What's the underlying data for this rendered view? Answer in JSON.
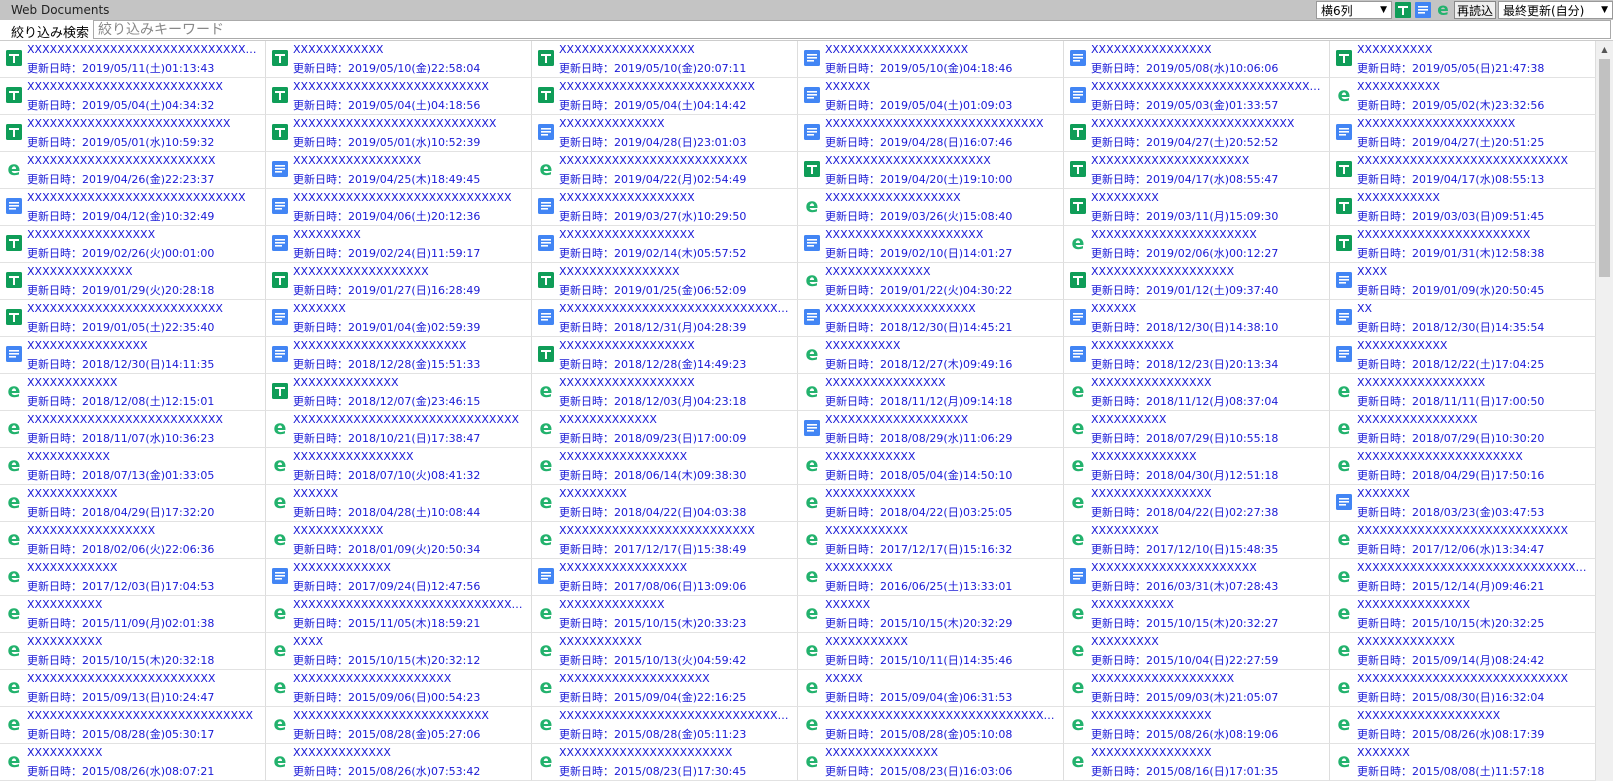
{
  "app": {
    "title": "Web Documents"
  },
  "toolbar": {
    "columns_value": "横6列",
    "reload_label": "再読込",
    "sort_value": "最終更新(自分)"
  },
  "filter": {
    "label": "絞り込み検索",
    "placeholder": "絞り込みキーワード"
  },
  "date_prefix": "更新日時：",
  "colors": {
    "sheet": "#0f9d58",
    "doc": "#4285f4",
    "web": "#23b26d",
    "link": "#1a1ad6"
  },
  "docs": [
    {
      "type": "sheet",
      "name": "XXXXXXXXXXXXXXXXXXXXXXXXXXXXXXXXXXX...",
      "date": "2019/05/11(土)01:13:43"
    },
    {
      "type": "sheet",
      "name": "XXXXXXXXXXXX",
      "date": "2019/05/10(金)22:58:04"
    },
    {
      "type": "sheet",
      "name": "XXXXXXXXXXXXXXXXXX",
      "date": "2019/05/10(金)20:07:11"
    },
    {
      "type": "doc",
      "name": "XXXXXXXXXXXXXXXXXXX",
      "date": "2019/05/10(金)04:18:46"
    },
    {
      "type": "doc",
      "name": "XXXXXXXXXXXXXXXX",
      "date": "2019/05/08(水)10:06:06"
    },
    {
      "type": "sheet",
      "name": "XXXXXXXXXX",
      "date": "2019/05/05(日)21:47:38"
    },
    {
      "type": "sheet",
      "name": "XXXXXXXXXXXXXXXXXXXXXXXXXX",
      "date": "2019/05/04(土)04:34:32"
    },
    {
      "type": "sheet",
      "name": "XXXXXXXXXXXXXXXXXXXXXXXXXX",
      "date": "2019/05/04(土)04:18:56"
    },
    {
      "type": "sheet",
      "name": "XXXXXXXXXXXXXXXXXXXXXXXXXX",
      "date": "2019/05/04(土)04:14:42"
    },
    {
      "type": "doc",
      "name": "XXXXXX",
      "date": "2019/05/04(土)01:09:03"
    },
    {
      "type": "doc",
      "name": "XXXXXXXXXXXXXXXXXXXXXXXXXXXXXXXX",
      "date": "2019/05/03(金)01:33:57"
    },
    {
      "type": "web",
      "name": "XXXXXXXXXXX",
      "date": "2019/05/02(木)23:32:56"
    },
    {
      "type": "sheet",
      "name": "XXXXXXXXXXXXXXXXXXXXXXXXXXX",
      "date": "2019/05/01(水)10:59:32"
    },
    {
      "type": "sheet",
      "name": "XXXXXXXXXXXXXXXXXXXXXXXXXXX",
      "date": "2019/05/01(水)10:52:39"
    },
    {
      "type": "doc",
      "name": "XXXXXXXXXXXXXX",
      "date": "2019/04/28(日)23:01:03"
    },
    {
      "type": "doc",
      "name": "XXXXXXXXXXXXXXXXXXXXXXXXXXXXX",
      "date": "2019/04/28(日)16:07:46"
    },
    {
      "type": "sheet",
      "name": "XXXXXXXXXXXXXXXXXXXXXXXXXXX",
      "date": "2019/04/27(土)20:52:52"
    },
    {
      "type": "doc",
      "name": "XXXXXXXXXXXXXXXXXXXXX",
      "date": "2019/04/27(土)20:51:25"
    },
    {
      "type": "web",
      "name": "XXXXXXXXXXXXXXXXXXXXXXXXX",
      "date": "2019/04/26(金)22:23:37"
    },
    {
      "type": "doc",
      "name": "XXXXXXXXXXXXXXXXX",
      "date": "2019/04/25(木)18:49:45"
    },
    {
      "type": "web",
      "name": "XXXXXXXXXXXXXXXXXXXXXXXXX",
      "date": "2019/04/22(月)02:54:49"
    },
    {
      "type": "sheet",
      "name": "XXXXXXXXXXXXXXXXXXXXXX",
      "date": "2019/04/20(土)19:10:00"
    },
    {
      "type": "sheet",
      "name": "XXXXXXXXXXXXXXXXXXXXX",
      "date": "2019/04/17(水)08:55:47"
    },
    {
      "type": "sheet",
      "name": "XXXXXXXXXXXXXXXXXXXXXXXXXXXX",
      "date": "2019/04/17(水)08:55:13"
    },
    {
      "type": "doc",
      "name": "XXXXXXXXXXXXXXXXXXXXXXXXXXXXX",
      "date": "2019/04/12(金)10:32:49"
    },
    {
      "type": "doc",
      "name": "XXXXXXXXXXXXXXXXXXXXXXXXXXXXX",
      "date": "2019/04/06(土)20:12:36"
    },
    {
      "type": "doc",
      "name": "XXXXXXXXXXXXXXXXXX",
      "date": "2019/03/27(水)10:29:50"
    },
    {
      "type": "web",
      "name": "XXXXXXXXXXXXXXXXXX",
      "date": "2019/03/26(火)15:08:40"
    },
    {
      "type": "sheet",
      "name": "XXXXXXXXX",
      "date": "2019/03/11(月)15:09:30"
    },
    {
      "type": "sheet",
      "name": "XXXXXXXXXXX",
      "date": "2019/03/03(日)09:51:45"
    },
    {
      "type": "sheet",
      "name": "XXXXXXXXXXXXXXXXX",
      "date": "2019/02/26(火)00:01:00"
    },
    {
      "type": "doc",
      "name": "XXXXXXXXX",
      "date": "2019/02/24(日)11:59:17"
    },
    {
      "type": "doc",
      "name": "XXXXXXXXXXXXXXXXXX",
      "date": "2019/02/14(木)05:57:52"
    },
    {
      "type": "doc",
      "name": "XXXXXXXXXXXXXXXXXXXXX",
      "date": "2019/02/10(日)14:01:27"
    },
    {
      "type": "web",
      "name": "XXXXXXXXXXXXXXXXXXXXXX",
      "date": "2019/02/06(水)00:12:27"
    },
    {
      "type": "sheet",
      "name": "XXXXXXXXXXXXXXXXXXXXXXX",
      "date": "2019/01/31(木)12:58:38"
    },
    {
      "type": "sheet",
      "name": "XXXXXXXXXXXXXX",
      "date": "2019/01/29(火)20:28:18"
    },
    {
      "type": "sheet",
      "name": "XXXXXXXXXXXXXXXXXX",
      "date": "2019/01/27(日)16:28:49"
    },
    {
      "type": "sheet",
      "name": "XXXXXXXXXXXXXXXX",
      "date": "2019/01/25(金)06:52:09"
    },
    {
      "type": "web",
      "name": "XXXXXXXXXXXXXX",
      "date": "2019/01/22(火)04:30:22"
    },
    {
      "type": "sheet",
      "name": "XXXXXXXXXXXXXXXXXXX",
      "date": "2019/01/12(土)09:37:40"
    },
    {
      "type": "doc",
      "name": "XXXX",
      "date": "2019/01/09(水)20:50:45"
    },
    {
      "type": "sheet",
      "name": "XXXXXXXXXXXXXXXXXXXXXXXXXX",
      "date": "2019/01/05(土)22:35:40"
    },
    {
      "type": "doc",
      "name": "XXXXXXX",
      "date": "2019/01/04(金)02:59:39"
    },
    {
      "type": "doc",
      "name": "XXXXXXXXXXXXXXXXXXXXXXXXXXXXXXXXXXX",
      "date": "2018/12/31(月)04:28:39"
    },
    {
      "type": "doc",
      "name": "XXXXXXXXXXXXXXXXXXXX",
      "date": "2018/12/30(日)14:45:21"
    },
    {
      "type": "doc",
      "name": "XXXXXX",
      "date": "2018/12/30(日)14:38:10"
    },
    {
      "type": "doc",
      "name": "XX",
      "date": "2018/12/30(日)14:35:54"
    },
    {
      "type": "doc",
      "name": "XXXXXXXXXXXXXXXX",
      "date": "2018/12/30(日)14:11:35"
    },
    {
      "type": "doc",
      "name": "XXXXXXXXXXXXXXXXXXXXXXX",
      "date": "2018/12/28(金)15:51:33"
    },
    {
      "type": "sheet",
      "name": "XXXXXXXXXXXXXXXXXX",
      "date": "2018/12/28(金)14:49:23"
    },
    {
      "type": "web",
      "name": "XXXXXXXXXX",
      "date": "2018/12/27(木)09:49:16"
    },
    {
      "type": "doc",
      "name": "XXXXXXXXXXX",
      "date": "2018/12/23(日)20:13:34"
    },
    {
      "type": "doc",
      "name": "XXXXXXXXXXXX",
      "date": "2018/12/22(土)17:04:25"
    },
    {
      "type": "web",
      "name": "XXXXXXXXXXXX",
      "date": "2018/12/08(土)12:15:01"
    },
    {
      "type": "sheet",
      "name": "XXXXXXXXXXXXXX",
      "date": "2018/12/07(金)23:46:15"
    },
    {
      "type": "web",
      "name": "XXXXXXXXXXXXXXXXXX",
      "date": "2018/12/03(月)04:23:18"
    },
    {
      "type": "web",
      "name": "XXXXXXXXXXXXXXXX",
      "date": "2018/11/12(月)09:14:18"
    },
    {
      "type": "web",
      "name": "XXXXXXXXXXXXXXXX",
      "date": "2018/11/12(月)08:37:04"
    },
    {
      "type": "web",
      "name": "XXXXXXXXXXXXXXXXX",
      "date": "2018/11/11(日)17:00:50"
    },
    {
      "type": "web",
      "name": "XXXXXXXXXXXXXXXXXXXXXXXXXX",
      "date": "2018/11/07(水)10:36:23"
    },
    {
      "type": "web",
      "name": "XXXXXXXXXXXXXXXXXXXXXXXXXXXXXX",
      "date": "2018/10/21(日)17:38:47"
    },
    {
      "type": "web",
      "name": "XXXXXXXXXXXXX",
      "date": "2018/09/23(日)17:00:09"
    },
    {
      "type": "doc",
      "name": "XXXXXXXXXXXXXXXXXXX",
      "date": "2018/08/29(水)11:06:29"
    },
    {
      "type": "web",
      "name": "XXXXXXXXXX",
      "date": "2018/07/29(日)10:55:18"
    },
    {
      "type": "web",
      "name": "XXXXXXXXXXXXXXXX",
      "date": "2018/07/29(日)10:30:20"
    },
    {
      "type": "web",
      "name": "XXXXXXXXXXX",
      "date": "2018/07/13(金)01:33:05"
    },
    {
      "type": "web",
      "name": "XXXXXXXXXXXXXXXX",
      "date": "2018/07/10(火)08:41:32"
    },
    {
      "type": "web",
      "name": "XXXXXXXXXXXXXXXXX",
      "date": "2018/06/14(木)09:38:30"
    },
    {
      "type": "web",
      "name": "XXXXXXXXXXXX",
      "date": "2018/05/04(金)14:50:10"
    },
    {
      "type": "web",
      "name": "XXXXXXXXXXXXXX",
      "date": "2018/04/30(月)12:51:18"
    },
    {
      "type": "web",
      "name": "XXXXXXXXXXXXXXXXXXXXXX",
      "date": "2018/04/29(日)17:50:16"
    },
    {
      "type": "web",
      "name": "XXXXXXXXXXXX",
      "date": "2018/04/29(日)17:32:20"
    },
    {
      "type": "web",
      "name": "XXXXXX",
      "date": "2018/04/28(土)10:08:44"
    },
    {
      "type": "web",
      "name": "XXXXXXXXX",
      "date": "2018/04/22(日)04:03:38"
    },
    {
      "type": "web",
      "name": "XXXXXXXXXXXX",
      "date": "2018/04/22(日)03:25:05"
    },
    {
      "type": "web",
      "name": "XXXXXXXXXXXXXXXX",
      "date": "2018/04/22(日)02:27:38"
    },
    {
      "type": "doc",
      "name": "XXXXXXX",
      "date": "2018/03/23(金)03:47:53"
    },
    {
      "type": "web",
      "name": "XXXXXXXXXXXXXXXXX",
      "date": "2018/02/06(火)22:06:36"
    },
    {
      "type": "web",
      "name": "XXXXXXXXXXXX",
      "date": "2018/01/09(火)20:50:34"
    },
    {
      "type": "web",
      "name": "XXXXXXXXXXXXXXXXXXXXXXXXXX",
      "date": "2017/12/17(日)15:38:49"
    },
    {
      "type": "web",
      "name": "XXXXXXXXXXX",
      "date": "2017/12/17(日)15:16:32"
    },
    {
      "type": "web",
      "name": "XXXXXXXXX",
      "date": "2017/12/10(日)15:48:35"
    },
    {
      "type": "web",
      "name": "XXXXXXXXXXXXXXXXXXXXXXXXXXXX",
      "date": "2017/12/06(水)13:34:47"
    },
    {
      "type": "web",
      "name": "XXXXXXXXXXXX",
      "date": "2017/12/03(日)17:04:53"
    },
    {
      "type": "doc",
      "name": "XXXXXXXXXXXXX",
      "date": "2017/09/24(日)12:47:56"
    },
    {
      "type": "doc",
      "name": "XXXXXXXXXXXXXXXXX",
      "date": "2017/08/06(日)13:09:06"
    },
    {
      "type": "web",
      "name": "XXXXXXXXX",
      "date": "2016/06/25(土)13:33:01"
    },
    {
      "type": "doc",
      "name": "XXXXXXXXXXXXXXXXXXXXXX",
      "date": "2016/03/31(木)07:28:43"
    },
    {
      "type": "web",
      "name": "XXXXXXXXXXXXXXXXXXXXXXXXXXXXXXXXXXX...",
      "date": "2015/12/14(月)09:46:21"
    },
    {
      "type": "web",
      "name": "XXXXXXXXXX",
      "date": "2015/11/09(月)02:01:38"
    },
    {
      "type": "web",
      "name": "XXXXXXXXXXXXXXXXXXXXXXXXXXXXXXXXXXXX",
      "date": "2015/11/05(木)18:59:21"
    },
    {
      "type": "web",
      "name": "XXXXXXXXXXXXXX",
      "date": "2015/10/15(木)20:33:23"
    },
    {
      "type": "web",
      "name": "XXXXXX",
      "date": "2015/10/15(木)20:32:29"
    },
    {
      "type": "web",
      "name": "XXXXXXXXXXX",
      "date": "2015/10/15(木)20:32:27"
    },
    {
      "type": "web",
      "name": "XXXXXXXXXXXXXXX",
      "date": "2015/10/15(木)20:32:25"
    },
    {
      "type": "web",
      "name": "XXXXXXXXXX",
      "date": "2015/10/15(木)20:32:18"
    },
    {
      "type": "web",
      "name": "XXXX",
      "date": "2015/10/15(木)20:32:12"
    },
    {
      "type": "web",
      "name": "XXXXXXXXXXX",
      "date": "2015/10/13(火)04:59:42"
    },
    {
      "type": "web",
      "name": "XXXXXXXXXXX",
      "date": "2015/10/11(日)14:35:46"
    },
    {
      "type": "web",
      "name": "XXXXXXXXX",
      "date": "2015/10/04(日)22:27:59"
    },
    {
      "type": "web",
      "name": "XXXXXXXXXXXXX",
      "date": "2015/09/14(月)08:24:42"
    },
    {
      "type": "web",
      "name": "XXXXXXXXXXXXXXXXXXXXXXXXX",
      "date": "2015/09/13(日)10:24:47"
    },
    {
      "type": "web",
      "name": "XXXXXXXXXXXXXXXXXXXXX",
      "date": "2015/09/06(日)00:54:23"
    },
    {
      "type": "web",
      "name": "XXXXXXXXXXXXXXXXXXXX",
      "date": "2015/09/04(金)22:16:25"
    },
    {
      "type": "web",
      "name": "XXXXX",
      "date": "2015/09/04(金)06:31:53"
    },
    {
      "type": "web",
      "name": "XXXXXXXXXXXXXXXXXXX",
      "date": "2015/09/03(木)21:05:07"
    },
    {
      "type": "web",
      "name": "XXXXXXXXXXXXXXXXXXXXXXXXXXXX",
      "date": "2015/08/30(日)16:32:04"
    },
    {
      "type": "web",
      "name": "XXXXXXXXXXXXXXXXXXXXXXXXXXXXXX",
      "date": "2015/08/28(金)05:30:17"
    },
    {
      "type": "web",
      "name": "XXXXXXXXXXXXXXXXXXXXXXXXXX",
      "date": "2015/08/28(金)05:27:06"
    },
    {
      "type": "web",
      "name": "XXXXXXXXXXXXXXXXXXXXXXXXXXXXXXXXXXXXXX",
      "date": "2015/08/28(金)05:11:23"
    },
    {
      "type": "web",
      "name": "XXXXXXXXXXXXXXXXXXXXXXXXXXXXXXXXXX",
      "date": "2015/08/28(金)05:10:08"
    },
    {
      "type": "web",
      "name": "XXXXXXXXXXXXXXXX",
      "date": "2015/08/26(水)08:19:06"
    },
    {
      "type": "web",
      "name": "XXXXXXXXXXXXXXXXXXX",
      "date": "2015/08/26(水)08:17:39"
    },
    {
      "type": "web",
      "name": "XXXXXXXXXX",
      "date": "2015/08/26(水)08:07:21"
    },
    {
      "type": "web",
      "name": "XXXXXXXXXXXXX",
      "date": "2015/08/26(水)07:53:42"
    },
    {
      "type": "web",
      "name": "XXXXXXXXXXXXXXXXXXXXXXX",
      "date": "2015/08/23(日)17:30:45"
    },
    {
      "type": "web",
      "name": "XXXXXXXXXXXXXXX",
      "date": "2015/08/23(日)16:03:06"
    },
    {
      "type": "web",
      "name": "XXXXXXXXXXXXXXXX",
      "date": "2015/08/16(日)17:01:35"
    },
    {
      "type": "web",
      "name": "XXXXXXX",
      "date": "2015/08/08(土)11:57:18"
    }
  ]
}
